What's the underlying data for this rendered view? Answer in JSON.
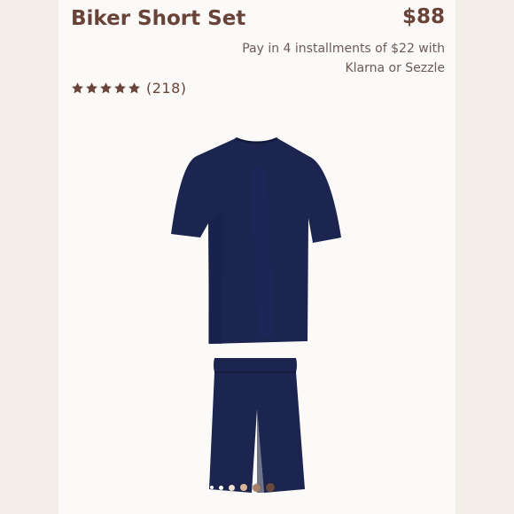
{
  "product": {
    "title": "Biker Short Set",
    "price": "$88",
    "installments_text": "Pay in 4 installments of $22 with Klarna or Sezzle",
    "rating": {
      "stars": 5,
      "count_label": "(218)"
    },
    "image_icon": "navy-tshirt-and-biker-shorts-image",
    "swatches": [
      {
        "color": "#ffffff"
      },
      {
        "color": "#ffffff"
      },
      {
        "color": "#f3e1cf"
      },
      {
        "color": "#d8b79a"
      },
      {
        "color": "#a87f68"
      },
      {
        "color": "#6a4a3e"
      }
    ]
  },
  "colors": {
    "brand_brown": "#6a4338",
    "navy_garment": "#1b2550",
    "page_bg": "#f3eee8"
  }
}
